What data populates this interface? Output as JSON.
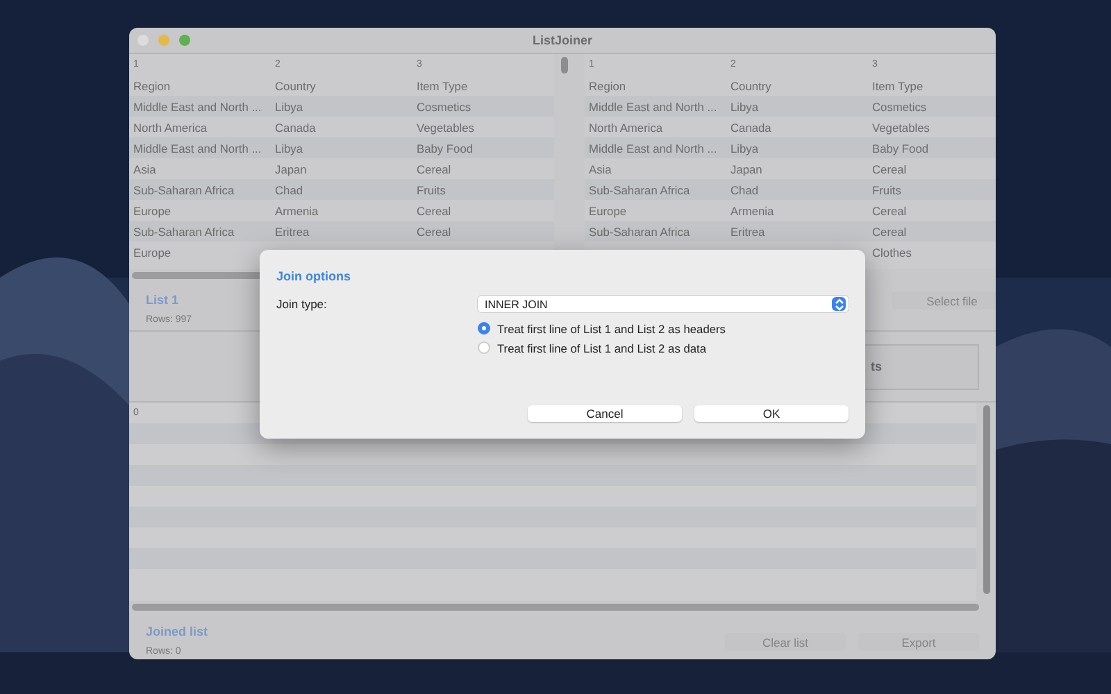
{
  "window": {
    "title": "ListJoiner"
  },
  "list1": {
    "columns": [
      "1",
      "2",
      "3"
    ],
    "rows": [
      [
        "Region",
        "Country",
        "Item Type"
      ],
      [
        "Middle East and North ...",
        "Libya",
        "Cosmetics"
      ],
      [
        "North America",
        "Canada",
        "Vegetables"
      ],
      [
        "Middle East and North ...",
        "Libya",
        "Baby Food"
      ],
      [
        "Asia",
        "Japan",
        "Cereal"
      ],
      [
        "Sub-Saharan Africa",
        "Chad",
        "Fruits"
      ],
      [
        "Europe",
        "Armenia",
        "Cereal"
      ],
      [
        "Sub-Saharan Africa",
        "Eritrea",
        "Cereal"
      ],
      [
        "Europe",
        null,
        null
      ]
    ],
    "title": "List 1",
    "rows_count": "Rows: 997"
  },
  "list2": {
    "columns": [
      "1",
      "2",
      "3"
    ],
    "rows": [
      [
        "Region",
        "Country",
        "Item Type"
      ],
      [
        "Middle East and North ...",
        "Libya",
        "Cosmetics"
      ],
      [
        "North America",
        "Canada",
        "Vegetables"
      ],
      [
        "Middle East and North ...",
        "Libya",
        "Baby Food"
      ],
      [
        "Asia",
        "Japan",
        "Cereal"
      ],
      [
        "Sub-Saharan Africa",
        "Chad",
        "Fruits"
      ],
      [
        "Europe",
        "Armenia",
        "Cereal"
      ],
      [
        "Sub-Saharan Africa",
        "Eritrea",
        "Cereal"
      ],
      [
        null,
        null,
        "Clothes"
      ]
    ],
    "select_button": "Select file"
  },
  "join_button": "ts",
  "joined": {
    "columns": [
      "0"
    ],
    "title": "Joined list",
    "rows_count": "Rows: 0",
    "buttons": [
      "Clear list",
      "Export"
    ]
  },
  "dialog": {
    "title": "Join options",
    "join_type_label": "Join type:",
    "join_type": "INNER JOIN",
    "options": [
      {
        "label": "Treat first line of List 1 and List 2 as headers",
        "selected": true
      },
      {
        "label": "Treat first line of List 1 and List 2 as data",
        "selected": false
      }
    ],
    "buttons": [
      "Cancel",
      "OK"
    ]
  }
}
